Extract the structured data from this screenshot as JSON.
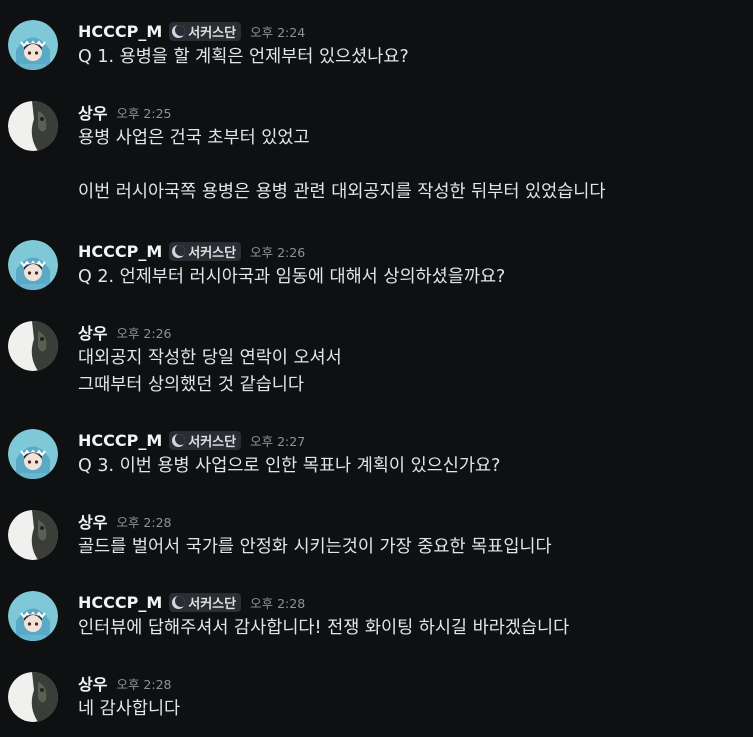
{
  "badge_label": "서커스단",
  "messages": [
    {
      "user": "HCCCP_M",
      "time": "오후 2:24",
      "lines": [
        "Q 1. 용병을 할 계획은 언제부터 있으셨나요?"
      ]
    },
    {
      "user": "상우",
      "time": "오후 2:25",
      "lines": [
        "용병 사업은 건국 초부터 있었고",
        "",
        "이번 러시아국쪽 용병은 용병 관련 대외공지를 작성한 뒤부터 있었습니다"
      ]
    },
    {
      "user": "HCCCP_M",
      "time": "오후 2:26",
      "lines": [
        "Q 2. 언제부터 러시아국과 임동에 대해서 상의하셨을까요?"
      ]
    },
    {
      "user": "상우",
      "time": "오후 2:26",
      "lines": [
        "대외공지 작성한 당일 연락이 오셔서",
        "그때부터 상의했던 것 같습니다"
      ]
    },
    {
      "user": "HCCCP_M",
      "time": "오후 2:27",
      "lines": [
        "Q 3. 이번 용병 사업으로 인한 목표나 계획이 있으신가요?"
      ]
    },
    {
      "user": "상우",
      "time": "오후 2:28",
      "lines": [
        "골드를 벌어서 국가를 안정화 시키는것이 가장 중요한 목표입니다"
      ]
    },
    {
      "user": "HCCCP_M",
      "time": "오후 2:28",
      "lines": [
        "인터뷰에 답해주셔서 감사합니다! 전쟁 화이팅 하시길 바라겠습니다"
      ]
    },
    {
      "user": "상우",
      "time": "오후 2:28",
      "lines": [
        "네 감사합니다"
      ]
    }
  ],
  "colors": {
    "background": "#0f1012",
    "username": "#f2f3f5",
    "timestamp": "#8e9199",
    "text": "#e3e5e8",
    "badge_bg": "#2b2d33"
  }
}
